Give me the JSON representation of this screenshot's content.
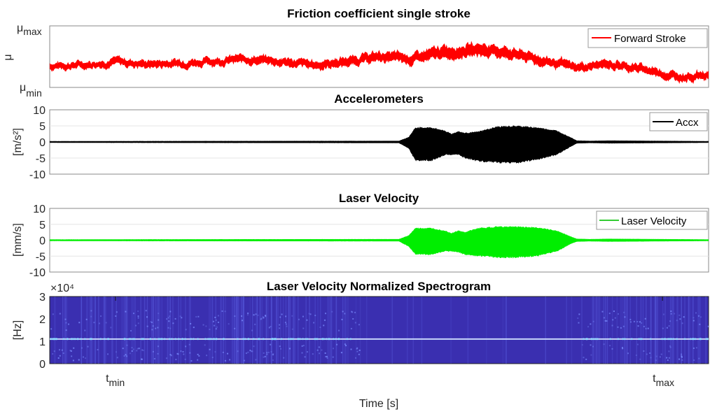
{
  "chart_data": [
    {
      "type": "line",
      "title": "Friction coefficient single stroke",
      "ylabel": "μ",
      "yticks": [
        {
          "base": "μ",
          "sub": "max",
          "value": 1
        },
        {
          "base": "μ",
          "sub": "min",
          "value": 0
        }
      ],
      "ylim": [
        0,
        1
      ],
      "xlim": [
        0,
        1
      ],
      "legend": {
        "label": "Forward Stroke",
        "position": "top-right"
      },
      "color": "#ff0000",
      "series": [
        {
          "name": "Forward Stroke",
          "x": [
            0,
            0.05,
            0.1,
            0.15,
            0.2,
            0.25,
            0.3,
            0.35,
            0.4,
            0.45,
            0.5,
            0.55,
            0.6,
            0.65,
            0.7,
            0.75,
            0.8,
            0.85,
            0.9,
            0.95,
            1.0
          ],
          "y": [
            0.35,
            0.37,
            0.42,
            0.38,
            0.4,
            0.43,
            0.46,
            0.42,
            0.36,
            0.42,
            0.5,
            0.46,
            0.57,
            0.62,
            0.56,
            0.43,
            0.32,
            0.38,
            0.3,
            0.18,
            0.2
          ],
          "band": [
            0.08,
            0.08,
            0.09,
            0.09,
            0.09,
            0.09,
            0.1,
            0.1,
            0.1,
            0.11,
            0.12,
            0.13,
            0.16,
            0.17,
            0.14,
            0.12,
            0.1,
            0.1,
            0.1,
            0.1,
            0.1
          ]
        }
      ]
    },
    {
      "type": "line",
      "title": "Accelerometers",
      "ylabel": "[m/s²]",
      "yticks": [
        -10,
        -5,
        0,
        5,
        10
      ],
      "ylim": [
        -10,
        10
      ],
      "xlim": [
        0,
        1
      ],
      "grid": true,
      "legend": {
        "label": "Accx",
        "position": "top-right"
      },
      "color": "#000000",
      "series": [
        {
          "name": "Accx",
          "envelope_x": [
            0,
            0.53,
            0.545,
            0.555,
            0.58,
            0.6,
            0.61,
            0.62,
            0.63,
            0.65,
            0.68,
            0.71,
            0.74,
            0.77,
            0.79,
            0.8,
            0.82,
            0.85,
            1.0
          ],
          "envelope_upper": [
            0.2,
            0.3,
            1.5,
            4.5,
            4.5,
            3.5,
            2.5,
            3.3,
            2.8,
            3.2,
            4.8,
            5.0,
            4.5,
            3.5,
            1.5,
            0.4,
            0.3,
            0.4,
            0.2
          ],
          "envelope_lower": [
            -0.2,
            -0.3,
            -2,
            -5.8,
            -5.8,
            -4,
            -4,
            -4,
            -5,
            -6,
            -6.5,
            -6.5,
            -5.5,
            -4,
            -1.5,
            -0.4,
            -0.3,
            -0.4,
            -0.2
          ]
        }
      ]
    },
    {
      "type": "line",
      "title": "Laser Velocity",
      "ylabel": "[mm/s]",
      "yticks": [
        -10,
        -5,
        0,
        5,
        10
      ],
      "ylim": [
        -10,
        10
      ],
      "xlim": [
        0,
        1
      ],
      "grid": true,
      "legend": {
        "label": "Laser Velocity",
        "position": "top-right"
      },
      "color": "#00ff00",
      "series": [
        {
          "name": "Laser Velocity",
          "envelope_x": [
            0,
            0.53,
            0.545,
            0.555,
            0.58,
            0.6,
            0.61,
            0.62,
            0.63,
            0.65,
            0.68,
            0.71,
            0.74,
            0.77,
            0.79,
            0.8,
            0.82,
            0.85,
            1.0
          ],
          "envelope_upper": [
            0.2,
            0.3,
            1.5,
            3.8,
            3.8,
            3.0,
            2.2,
            3.0,
            2.5,
            3.8,
            4.3,
            4.3,
            4.0,
            3.0,
            1.2,
            0.4,
            0.3,
            0.4,
            0.2
          ],
          "envelope_lower": [
            -0.2,
            -0.3,
            -2,
            -4.5,
            -4.5,
            -3.5,
            -3.5,
            -3.8,
            -4.5,
            -5,
            -5.5,
            -5.5,
            -5,
            -3.5,
            -1.2,
            -0.4,
            -0.3,
            -0.4,
            -0.2
          ]
        }
      ]
    },
    {
      "type": "heatmap",
      "title": "Laser Velocity Normalized Spectrogram",
      "ylabel": "[Hz]",
      "yticks": [
        0,
        1,
        2,
        3
      ],
      "y_exponent": "×10⁴",
      "ylim": [
        0,
        30000
      ],
      "xlim": [
        0,
        1
      ],
      "dominant_frequency_hz": 11000,
      "background_color": "#3a2fb0",
      "line_color": "#d0e0ff"
    }
  ],
  "xlabel": "Time [s]",
  "xticks": [
    {
      "base": "t",
      "sub": "min",
      "value": 0.1
    },
    {
      "base": "t",
      "sub": "max",
      "value": 0.93
    }
  ]
}
